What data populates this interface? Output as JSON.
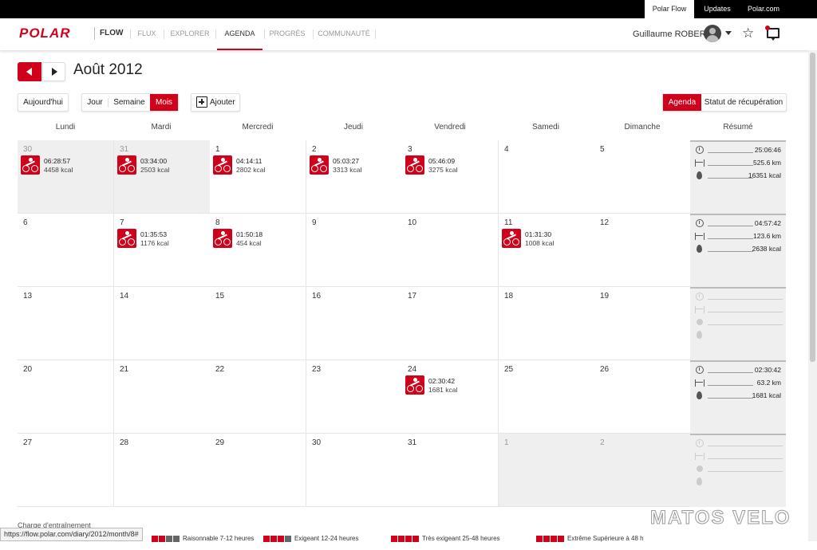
{
  "topbar": {
    "items": [
      "Polar Flow",
      "Updates",
      "Polar.com"
    ]
  },
  "nav": {
    "logo": "POLAR",
    "flow": "FLOW",
    "items": [
      "FLUX",
      "EXPLORER",
      "AGENDA",
      "PROGRÈS",
      "COMMUNAUTÉ"
    ],
    "active": "AGENDA",
    "user": "Guillaume ROBERT",
    "star": "☆"
  },
  "toolbar": {
    "month_title": "Août 2012",
    "today": "Aujourd'hui",
    "view_day": "Jour",
    "view_week": "Semaine",
    "view_month": "Mois",
    "add": "Ajouter",
    "agenda": "Agenda",
    "recovery": "Statut de récupération"
  },
  "weekdays": [
    "Lundi",
    "Mardi",
    "Mercredi",
    "Jeudi",
    "Vendredi",
    "Samedi",
    "Dimanche",
    "Résumé"
  ],
  "weeks": [
    {
      "days": [
        {
          "n": "30",
          "other": true,
          "dur": "06:28:57",
          "kcal": "4458 kcal"
        },
        {
          "n": "31",
          "other": true,
          "dur": "03:34:00",
          "kcal": "2503 kcal"
        },
        {
          "n": "1",
          "dur": "04:14:11",
          "kcal": "2802 kcal"
        },
        {
          "n": "2",
          "dur": "05:03:27",
          "kcal": "3313 kcal"
        },
        {
          "n": "3",
          "dur": "05:46:09",
          "kcal": "3275 kcal"
        },
        {
          "n": "4"
        },
        {
          "n": "5"
        }
      ],
      "summary": {
        "time": "25:06:46",
        "dist": "525.6 km",
        "kcal": "16351 kcal"
      }
    },
    {
      "days": [
        {
          "n": "6"
        },
        {
          "n": "7",
          "dur": "01:35:53",
          "kcal": "1176 kcal"
        },
        {
          "n": "8",
          "dur": "01:50:18",
          "kcal": "454 kcal"
        },
        {
          "n": "9"
        },
        {
          "n": "10"
        },
        {
          "n": "11",
          "dur": "01:31:30",
          "kcal": "1008 kcal"
        },
        {
          "n": "12"
        }
      ],
      "summary": {
        "time": "04:57:42",
        "dist": "123.6 km",
        "kcal": "2638 kcal"
      }
    },
    {
      "days": [
        {
          "n": "13"
        },
        {
          "n": "14"
        },
        {
          "n": "15"
        },
        {
          "n": "16"
        },
        {
          "n": "17"
        },
        {
          "n": "18"
        },
        {
          "n": "19"
        }
      ],
      "summary": null
    },
    {
      "days": [
        {
          "n": "20"
        },
        {
          "n": "21"
        },
        {
          "n": "22"
        },
        {
          "n": "23"
        },
        {
          "n": "24",
          "dur": "02:30:42",
          "kcal": "1681 kcal"
        },
        {
          "n": "25"
        },
        {
          "n": "26"
        }
      ],
      "summary": {
        "time": "02:30:42",
        "dist": "63.2 km",
        "kcal": "1681 kcal"
      }
    },
    {
      "days": [
        {
          "n": "27"
        },
        {
          "n": "28"
        },
        {
          "n": "29"
        },
        {
          "n": "30"
        },
        {
          "n": "31"
        },
        {
          "n": "1",
          "other": true
        },
        {
          "n": "2",
          "other": true
        }
      ],
      "summary": null
    }
  ],
  "charge": {
    "title": "Charge d'entraînement",
    "legend": [
      {
        "red": 2,
        "label": "Raisonnable 7-12 heures"
      },
      {
        "red": 3,
        "label": "Exigeant 12-24 heures"
      },
      {
        "red": 4,
        "label": "Très exigeant 25-48 heures"
      },
      {
        "red": 5,
        "label": "Extrême Supérieure à 48 h"
      }
    ]
  },
  "status_url": "https://flow.polar.com/diary/2012/month/8#",
  "watermark": "MATOS VELO",
  "colors": {
    "accent": "#d0021b",
    "topbar": "#000000",
    "other_month": "#efefef"
  }
}
